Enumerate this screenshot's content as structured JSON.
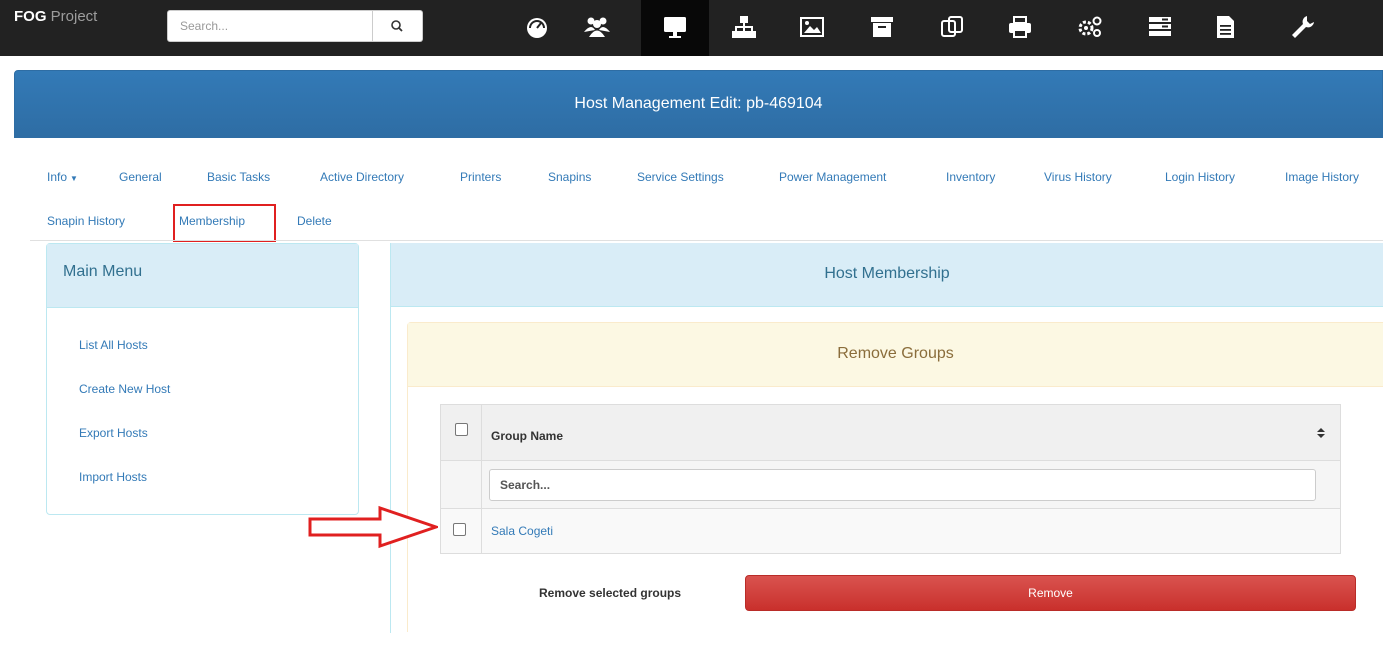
{
  "navbar": {
    "brand_bold": "FOG",
    "brand_rest": " Project",
    "search_placeholder": "Search...",
    "icons": [
      "dashboard-icon",
      "users-icon",
      "hosts-icon",
      "groups-icon",
      "images-icon",
      "storage-icon",
      "snapins-icon",
      "printers-icon",
      "service-icon",
      "tasks-icon",
      "reports-icon",
      "settings-icon"
    ]
  },
  "header": {
    "title": "Host Management Edit: pb-469104"
  },
  "tabs": [
    {
      "label": "Info"
    },
    {
      "label": "General"
    },
    {
      "label": "Basic Tasks"
    },
    {
      "label": "Active Directory"
    },
    {
      "label": "Printers"
    },
    {
      "label": "Snapins"
    },
    {
      "label": "Service Settings"
    },
    {
      "label": "Power Management"
    },
    {
      "label": "Inventory"
    },
    {
      "label": "Virus History"
    },
    {
      "label": "Login History"
    },
    {
      "label": "Image History"
    },
    {
      "label": "Snapin History"
    },
    {
      "label": "Membership"
    },
    {
      "label": "Delete"
    }
  ],
  "main_menu": {
    "title": "Main Menu",
    "items": [
      {
        "label": "List All Hosts"
      },
      {
        "label": "Create New Host"
      },
      {
        "label": "Export Hosts"
      },
      {
        "label": "Import Hosts"
      }
    ]
  },
  "membership": {
    "title": "Host Membership",
    "remove_title": "Remove Groups",
    "column_header": "Group Name",
    "search_placeholder": "Search...",
    "groups": [
      {
        "name": "Sala Cogeti"
      }
    ],
    "remove_label": "Remove selected groups",
    "remove_button": "Remove"
  },
  "colors": {
    "navbar": "#222222",
    "primary": "#337ab7",
    "info_bg": "#d9edf7",
    "warning_bg": "#fcf8e3",
    "danger": "#d9534f",
    "annotation": "#e02020"
  }
}
